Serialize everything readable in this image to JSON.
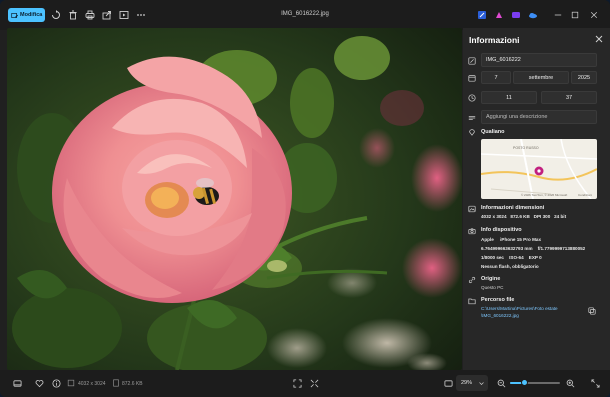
{
  "titlebar": {
    "edit_label": "Modifica",
    "file_title": "IMG_6016222.jpg"
  },
  "panel": {
    "title": "Informazioni",
    "filename": "IMG_6016222",
    "date_day": "7",
    "date_month": "settembre",
    "date_year": "2025",
    "time_hour": "11",
    "time_minute": "37",
    "description_placeholder": "Aggiungi una descrizione",
    "location_title": "Qualiano",
    "map_place": "POSTO RUSSO",
    "map_copyright": "© 2026 TomTom, © 2026 Microsoft",
    "map_terms": "Condizioni",
    "dimensions_title": "Informazioni dimensioni",
    "dimensions": "4032 x 3024",
    "filesize": "872.6 KB",
    "dpi": "DPI 300",
    "bits": "24 bit",
    "device_title": "Info dispositivo",
    "device_maker": "Apple",
    "device_model": "iPhone 15 Pro Max",
    "focal": "6.764999663632793 mm",
    "aperture": "f/1.7799999713880052",
    "shutter": "1/8000 sec",
    "iso": "ISO-64",
    "exp": "EXP 0",
    "flash": "Nessun flash, obbligatorio",
    "origin_title": "Origine",
    "origin_value": "Questo PC",
    "path_title": "Percorso file",
    "path_line1": "C:\\Users\\Martina\\Pictures\\Foto estate",
    "path_line2": "\\IMG_6016222.jpg"
  },
  "bottombar": {
    "dimensions": "4032 x 3024",
    "filesize": "872.6 KB",
    "zoom": "29%",
    "zoom_level": 0.29
  },
  "icons": {
    "edit": "pencil-image-icon",
    "rotate": "rotate-icon",
    "delete": "trash-icon",
    "print": "print-icon",
    "share": "share-icon",
    "slideshow": "slideshow-icon",
    "more": "more-icon",
    "accent": "#4cc2ff"
  }
}
